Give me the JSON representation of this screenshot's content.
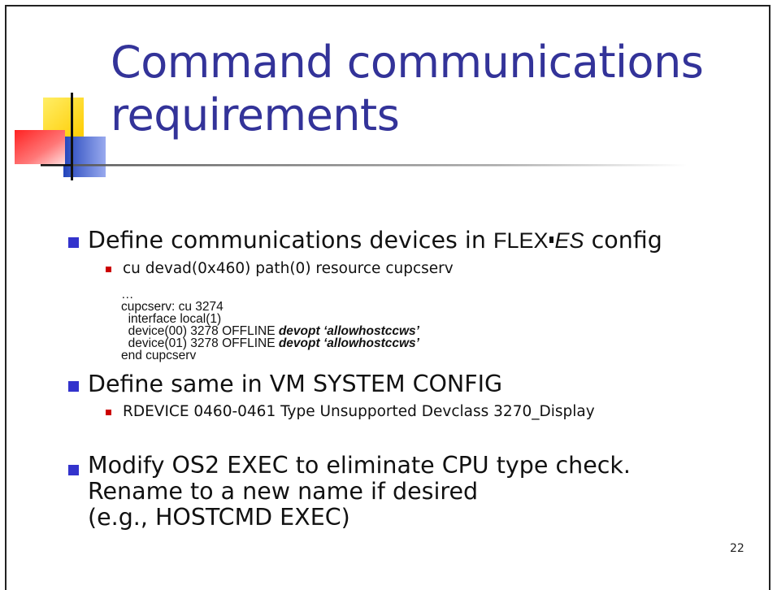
{
  "slide": {
    "title_line1": "Command communications",
    "title_line2": "requirements",
    "number": "22"
  },
  "bullets": [
    {
      "pre": "Define communications devices in ",
      "flex": "FLEX",
      "es": "ES",
      "post": " config"
    },
    {
      "text": "Define same in VM SYSTEM CONFIG"
    },
    {
      "lines": [
        "Modify OS2 EXEC to eliminate CPU type check.",
        "Rename to a new name if desired",
        "(e.g., HOSTCMD EXEC)"
      ]
    }
  ],
  "sub_bullets": [
    "cu devad(0x460) path(0) resource cupcserv",
    "RDEVICE 0460-0461 Type Unsupported Devclass 3270_Display"
  ],
  "code": {
    "ellipsis": "…",
    "line1": "cupcserv: cu 3274",
    "line2": "  interface local(1)",
    "dev0": "  device(00) 3278 OFFLINE ",
    "dev1": "  device(01) 3278 OFFLINE ",
    "devopt": "devopt ‘allowhostccws’",
    "end": "end cupcserv"
  },
  "colors": {
    "title": "#333399",
    "bullet": "#3333cc",
    "sub_bullet": "#cc0000",
    "deco_yellow": "#ffcc00",
    "deco_red": "#ff3333",
    "deco_blue": "#3366cc"
  }
}
